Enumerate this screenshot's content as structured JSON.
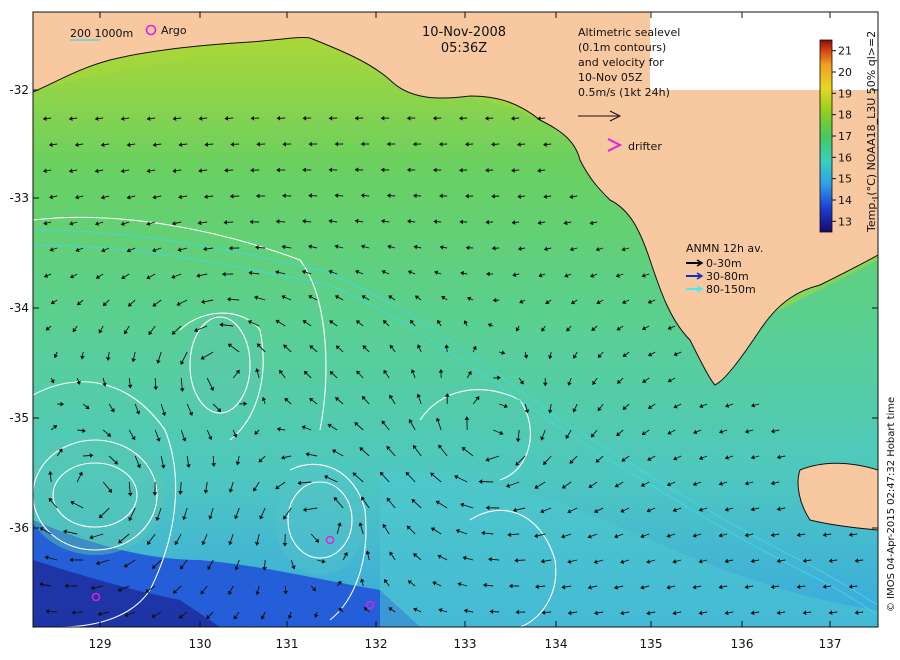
{
  "map": {
    "date": "10-Nov-2008",
    "time": "05:36Z",
    "scale_label": "200  1000m",
    "argo_label": "Argo",
    "altimetry_lines": [
      "Altimetric sealevel",
      "(0.1m contours)",
      "and velocity for",
      "10-Nov 05Z",
      "0.5m/s (1kt 24h)"
    ],
    "drifter_label": "drifter",
    "anmn": {
      "title": "ANMN 12h av.",
      "items": [
        {
          "label": "0-30m",
          "color": "#000000"
        },
        {
          "label": "30-80m",
          "color": "#1030c0"
        },
        {
          "label": "80-150m",
          "color": "#40f0f0"
        }
      ]
    },
    "colorbar": {
      "label": "Temp. (°C) NOAA18_L3U 50% ql>=2",
      "ticks": [
        "13",
        "14",
        "15",
        "16",
        "17",
        "18",
        "19",
        "20",
        "21"
      ],
      "colors": [
        "#140a6e",
        "#1c3cd0",
        "#2ea0e8",
        "#38d0c0",
        "#46c860",
        "#8ccf20",
        "#e8d820",
        "#f0a020",
        "#d04010",
        "#8a0a0a"
      ]
    },
    "credit": "© IMOS 04-Apr-2015 02:47:32 Hobart time",
    "lat_labels": [
      "-32",
      "-33",
      "-34",
      "-35",
      "-36"
    ],
    "lon_labels": [
      "129",
      "130",
      "131",
      "132",
      "133",
      "134",
      "135",
      "136",
      "137"
    ],
    "colors": {
      "land": "#f8c8a0",
      "sea_base": "#6ad08a",
      "sea_warm": "#b8d830",
      "sea_cool": "#4ec8c0",
      "sea_cold": "#2050d8",
      "contour": "#ffffff",
      "isobath": "#40d8e8",
      "argo": "#e020e0"
    }
  }
}
